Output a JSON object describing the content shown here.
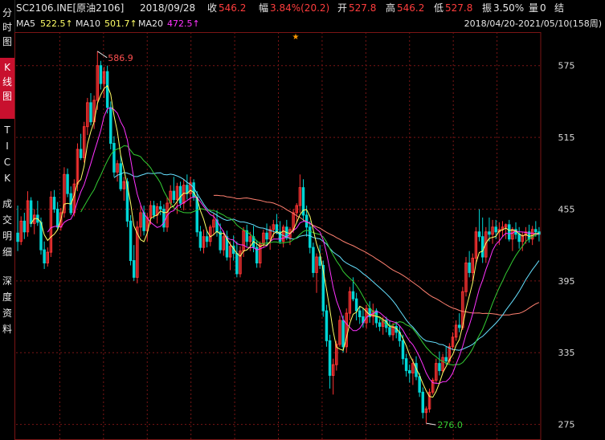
{
  "sidebar": {
    "items": [
      {
        "label": [
          "分",
          "时",
          "图"
        ],
        "active": false
      },
      {
        "label": [
          "K",
          "线",
          "图"
        ],
        "active": true
      },
      {
        "label": [
          "T",
          "I",
          "C",
          "K"
        ],
        "active": false
      },
      {
        "label": [
          "成",
          "交",
          "明",
          "细"
        ],
        "active": false
      },
      {
        "label": [
          "深",
          "度",
          "资",
          "料"
        ],
        "active": false
      }
    ]
  },
  "header": {
    "symbol": "SC2106.INE[原油2106]",
    "date": "2018/09/28",
    "close_label": "收",
    "close_value": "546.2",
    "change_label": "幅",
    "change_value": "3.84%(20.2)",
    "open_label": "开",
    "open_value": "527.8",
    "high_label": "高",
    "high_value": "546.2",
    "low_label": "低",
    "low_value": "527.8",
    "amplitude_label": "振",
    "amplitude_value": "3.50%",
    "volume_label": "量",
    "volume_value": "0",
    "settle_label": "结"
  },
  "ma": {
    "ma5_label": "MA5",
    "ma5_value": "522.5↑",
    "ma10_label": "MA10",
    "ma10_value": "501.7↑",
    "ma20_label": "MA20",
    "ma20_value": "472.5↑",
    "range": "2018/04/20-2021/05/10(158周)"
  },
  "colors": {
    "up": "#ff3333",
    "down": "#00d5d5",
    "ma5": "#ffff66",
    "ma10": "#ff33ff",
    "ma20": "#33cc33",
    "ma_cyan": "#66e0ff",
    "ma_salmon": "#ff8070",
    "grid": "#7a1515"
  },
  "chart_data": {
    "type": "candlestick",
    "ylim": [
      262,
      603
    ],
    "yticks": [
      575,
      515,
      455,
      395,
      335,
      275
    ],
    "high_annotation": "586.9",
    "low_annotation": "276.0",
    "weeks": 158,
    "ohlc": [
      [
        435,
        458,
        420,
        428
      ],
      [
        428,
        449,
        425,
        445
      ],
      [
        445,
        452,
        430,
        436
      ],
      [
        436,
        470,
        432,
        462
      ],
      [
        462,
        465,
        440,
        443
      ],
      [
        443,
        455,
        434,
        450
      ],
      [
        450,
        462,
        441,
        444
      ],
      [
        444,
        448,
        417,
        421
      ],
      [
        421,
        428,
        405,
        410
      ],
      [
        410,
        423,
        407,
        419
      ],
      [
        419,
        470,
        415,
        465
      ],
      [
        465,
        471,
        452,
        455
      ],
      [
        455,
        461,
        438,
        440
      ],
      [
        440,
        456,
        437,
        452
      ],
      [
        452,
        490,
        448,
        484
      ],
      [
        484,
        489,
        465,
        468
      ],
      [
        468,
        474,
        450,
        452
      ],
      [
        452,
        480,
        449,
        476
      ],
      [
        476,
        510,
        470,
        505
      ],
      [
        505,
        518,
        496,
        498
      ],
      [
        498,
        528,
        494,
        524
      ],
      [
        524,
        548,
        517,
        544
      ],
      [
        544,
        552,
        525,
        528
      ],
      [
        528,
        550,
        522,
        546
      ],
      [
        546,
        587,
        538,
        575
      ],
      [
        575,
        579,
        555,
        560
      ],
      [
        560,
        574,
        548,
        570
      ],
      [
        570,
        575,
        535,
        540
      ],
      [
        540,
        545,
        505,
        510
      ],
      [
        510,
        516,
        482,
        486
      ],
      [
        486,
        496,
        478,
        493
      ],
      [
        493,
        500,
        470,
        472
      ],
      [
        472,
        482,
        462,
        478
      ],
      [
        478,
        481,
        440,
        445
      ],
      [
        445,
        450,
        408,
        412
      ],
      [
        412,
        425,
        395,
        398
      ],
      [
        398,
        445,
        393,
        440
      ],
      [
        440,
        458,
        432,
        452
      ],
      [
        452,
        458,
        433,
        437
      ],
      [
        437,
        452,
        428,
        448
      ],
      [
        448,
        462,
        442,
        458
      ],
      [
        458,
        462,
        447,
        450
      ],
      [
        450,
        460,
        443,
        457
      ],
      [
        457,
        462,
        450,
        455
      ],
      [
        455,
        459,
        436,
        440
      ],
      [
        440,
        465,
        436,
        460
      ],
      [
        460,
        475,
        456,
        470
      ],
      [
        470,
        482,
        460,
        463
      ],
      [
        463,
        477,
        451,
        474
      ],
      [
        474,
        478,
        456,
        460
      ],
      [
        460,
        480,
        454,
        475
      ],
      [
        475,
        484,
        463,
        468
      ],
      [
        468,
        482,
        457,
        477
      ],
      [
        477,
        480,
        462,
        465
      ],
      [
        465,
        470,
        432,
        436
      ],
      [
        436,
        441,
        420,
        423
      ],
      [
        423,
        438,
        418,
        432
      ],
      [
        432,
        437,
        423,
        428
      ],
      [
        428,
        442,
        424,
        440
      ],
      [
        440,
        452,
        433,
        446
      ],
      [
        446,
        454,
        432,
        436
      ],
      [
        436,
        443,
        418,
        421
      ],
      [
        421,
        437,
        416,
        432
      ],
      [
        432,
        437,
        412,
        415
      ],
      [
        415,
        428,
        404,
        424
      ],
      [
        424,
        433,
        412,
        418
      ],
      [
        418,
        428,
        398,
        401
      ],
      [
        401,
        424,
        398,
        420
      ],
      [
        420,
        440,
        415,
        437
      ],
      [
        437,
        442,
        424,
        428
      ],
      [
        428,
        436,
        420,
        432
      ],
      [
        432,
        441,
        419,
        423
      ],
      [
        423,
        429,
        406,
        410
      ],
      [
        410,
        428,
        406,
        426
      ],
      [
        426,
        438,
        423,
        435
      ],
      [
        435,
        443,
        425,
        430
      ],
      [
        430,
        441,
        421,
        438
      ],
      [
        438,
        446,
        431,
        442
      ],
      [
        442,
        451,
        434,
        436
      ],
      [
        436,
        445,
        426,
        428
      ],
      [
        428,
        442,
        423,
        440
      ],
      [
        440,
        446,
        429,
        431
      ],
      [
        431,
        440,
        425,
        438
      ],
      [
        438,
        455,
        435,
        452
      ],
      [
        452,
        460,
        444,
        458
      ],
      [
        458,
        484,
        452,
        473
      ],
      [
        473,
        480,
        445,
        450
      ],
      [
        450,
        458,
        432,
        440
      ],
      [
        440,
        445,
        418,
        423
      ],
      [
        423,
        427,
        398,
        402
      ],
      [
        402,
        418,
        385,
        415
      ],
      [
        415,
        425,
        405,
        408
      ],
      [
        408,
        412,
        365,
        370
      ],
      [
        370,
        375,
        340,
        345
      ],
      [
        345,
        350,
        305,
        316
      ],
      [
        316,
        330,
        300,
        325
      ],
      [
        325,
        345,
        320,
        342
      ],
      [
        342,
        366,
        340,
        362
      ],
      [
        362,
        366,
        335,
        340
      ],
      [
        340,
        372,
        335,
        368
      ],
      [
        368,
        390,
        362,
        386
      ],
      [
        386,
        398,
        378,
        380
      ],
      [
        380,
        385,
        362,
        370
      ],
      [
        370,
        374,
        359,
        365
      ],
      [
        365,
        372,
        356,
        360
      ],
      [
        360,
        375,
        355,
        372
      ],
      [
        372,
        378,
        360,
        365
      ],
      [
        365,
        376,
        358,
        370
      ],
      [
        370,
        372,
        356,
        360
      ],
      [
        360,
        363,
        353,
        357
      ],
      [
        357,
        365,
        350,
        362
      ],
      [
        362,
        365,
        352,
        356
      ],
      [
        356,
        362,
        348,
        350
      ],
      [
        350,
        360,
        345,
        357
      ],
      [
        357,
        361,
        347,
        352
      ],
      [
        352,
        357,
        340,
        345
      ],
      [
        345,
        350,
        325,
        330
      ],
      [
        330,
        334,
        315,
        320
      ],
      [
        320,
        325,
        310,
        318
      ],
      [
        318,
        330,
        308,
        326
      ],
      [
        326,
        332,
        312,
        315
      ],
      [
        315,
        318,
        298,
        302
      ],
      [
        302,
        306,
        280,
        285
      ],
      [
        285,
        290,
        276,
        288
      ],
      [
        288,
        305,
        285,
        302
      ],
      [
        302,
        314,
        300,
        312
      ],
      [
        312,
        330,
        309,
        326
      ],
      [
        326,
        336,
        316,
        320
      ],
      [
        320,
        334,
        318,
        331
      ],
      [
        331,
        340,
        325,
        328
      ],
      [
        328,
        343,
        326,
        340
      ],
      [
        340,
        352,
        337,
        348
      ],
      [
        348,
        362,
        345,
        358
      ],
      [
        358,
        368,
        352,
        356
      ],
      [
        356,
        390,
        354,
        386
      ],
      [
        386,
        415,
        382,
        410
      ],
      [
        410,
        420,
        398,
        402
      ],
      [
        402,
        418,
        395,
        414
      ],
      [
        414,
        440,
        409,
        436
      ],
      [
        436,
        455,
        428,
        432
      ],
      [
        432,
        448,
        410,
        415
      ],
      [
        415,
        440,
        410,
        436
      ],
      [
        436,
        448,
        428,
        434
      ],
      [
        434,
        446,
        426,
        440
      ],
      [
        440,
        446,
        430,
        436
      ],
      [
        436,
        444,
        425,
        438
      ],
      [
        438,
        445,
        432,
        440
      ],
      [
        440,
        443,
        430,
        442
      ],
      [
        442,
        446,
        428,
        430
      ],
      [
        430,
        440,
        420,
        438
      ],
      [
        438,
        444,
        430,
        434
      ],
      [
        434,
        440,
        422,
        428
      ],
      [
        428,
        436,
        420,
        433
      ],
      [
        433,
        440,
        426,
        436
      ],
      [
        436,
        442,
        427,
        430
      ],
      [
        430,
        441,
        425,
        438
      ],
      [
        438,
        445,
        432,
        436
      ],
      [
        436,
        440,
        428,
        434
      ]
    ]
  }
}
